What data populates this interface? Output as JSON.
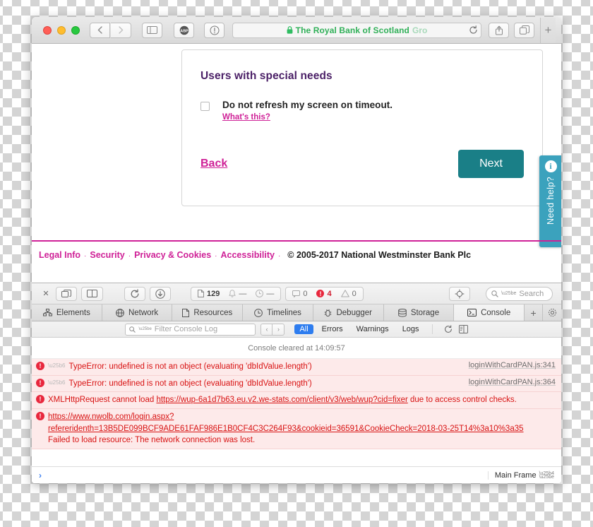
{
  "browser": {
    "window_controls": {
      "close": "close",
      "minimize": "minimize",
      "zoom": "zoom"
    },
    "back_label": "‹",
    "forward_label": "›",
    "sidebar_label": "sidebar",
    "adblock_label": "ABP",
    "reader_label": "ⓘ",
    "address": {
      "lock": "🔒",
      "title_main": "The Royal Bank of Scotland ",
      "title_dim": "Gro",
      "reload": "↻"
    },
    "share_label": "share",
    "tabs_overview_label": "tab-overview",
    "new_tab_label": "+"
  },
  "page": {
    "section_title": "Users with special needs",
    "checkbox": {
      "checked": false,
      "label": "Do not refresh my screen on timeout."
    },
    "whats_this": "What's this?",
    "back_link": "Back",
    "next_button": "Next",
    "need_help": {
      "icon": "i",
      "label": "Need help?"
    },
    "footer": {
      "links": [
        "Legal Info",
        "Security",
        "Privacy & Cookies",
        "Accessibility"
      ],
      "separator": "·",
      "copyright": "© 2005-2017 National Westminster Bank Plc"
    },
    "colors": {
      "accent_pink": "#cf2197",
      "heading_purple": "#4b2067",
      "teal": "#1a7f87",
      "help_blue": "#3ba2bd"
    }
  },
  "devtools": {
    "toolbar": {
      "close": "✕",
      "dock_label": "dock-window",
      "split_label": "dock-side",
      "reload_label": "reload",
      "download_label": "download",
      "resources_count": "129",
      "alerts_count": "—",
      "time_count": "—",
      "messages_count": "0",
      "errors_count": "4",
      "warnings_count": "0",
      "inspect_label": "inspect-node",
      "search_placeholder": "Search"
    },
    "tabs": [
      {
        "label": "Elements",
        "active": false
      },
      {
        "label": "Network",
        "active": false
      },
      {
        "label": "Resources",
        "active": false
      },
      {
        "label": "Timelines",
        "active": false
      },
      {
        "label": "Debugger",
        "active": false
      },
      {
        "label": "Storage",
        "active": false
      },
      {
        "label": "Console",
        "active": true
      }
    ],
    "tab_add": "+",
    "tab_settings": "gear",
    "console_filter": {
      "placeholder": "Filter Console Log",
      "prev": "‹",
      "next": "›",
      "scopes": [
        {
          "label": "All",
          "active": true
        },
        {
          "label": "Errors",
          "active": false
        },
        {
          "label": "Warnings",
          "active": false
        },
        {
          "label": "Logs",
          "active": false
        }
      ],
      "clear_label": "clear-console",
      "split_label": "split-console"
    },
    "console": {
      "cleared_notice": "Console cleared at 14:09:57",
      "messages": [
        {
          "level": "error",
          "expandable": true,
          "text": "TypeError: undefined is not an object (evaluating 'dbIdValue.length')",
          "source": "loginWithCardPAN.js:341"
        },
        {
          "level": "error",
          "expandable": true,
          "text": "TypeError: undefined is not an object (evaluating 'dbIdValue.length')",
          "source": "loginWithCardPAN.js:364"
        },
        {
          "level": "error",
          "expandable": false,
          "prefix": "XMLHttpRequest cannot load ",
          "link": "https://wup-6a1d7b63.eu.v2.we-stats.com/client/v3/web/wup?cid=fixer",
          "suffix": " due to access control checks.",
          "source": ""
        },
        {
          "level": "error",
          "expandable": false,
          "link_line1": "https://www.nwolb.com/login.aspx?",
          "link_line2": "refereridenth=13B5DE099BCF9ADE61FAF986E1B0CF4C3C264F93&cookieid=36591&CookieCheck=2018-03-25T14%3a10%3a35",
          "text": "Failed to load resource: The network connection was lost.",
          "source": ""
        }
      ],
      "prompt_caret": "›",
      "frame_selector": "Main Frame"
    }
  }
}
